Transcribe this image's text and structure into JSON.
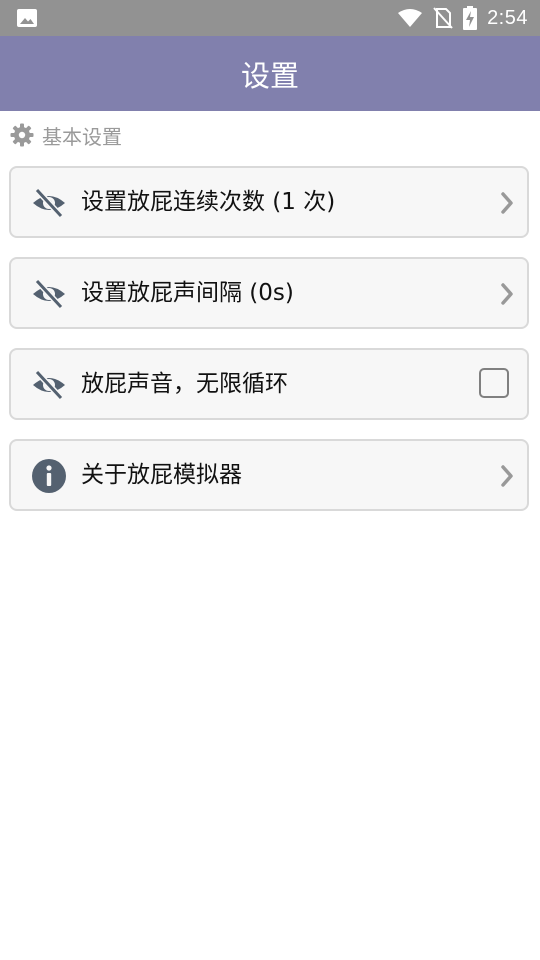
{
  "status_bar": {
    "time": "2:54",
    "left_icon": "image-icon",
    "icons": [
      "wifi-icon",
      "no-sim-icon",
      "battery-charging-icon"
    ]
  },
  "app_bar": {
    "title": "设置"
  },
  "section": {
    "icon": "gear-icon",
    "title": "基本设置"
  },
  "settings": [
    {
      "icon": "eye-off-icon",
      "label": "设置放屁连续次数 (1 次)",
      "control": "chevron"
    },
    {
      "icon": "eye-off-icon",
      "label": "设置放屁声间隔 (0s)",
      "control": "chevron"
    },
    {
      "icon": "eye-off-icon",
      "label": "放屁声音，无限循环",
      "control": "checkbox",
      "checked": false
    },
    {
      "icon": "info-icon",
      "label": "关于放屁模拟器",
      "control": "chevron"
    }
  ],
  "colors": {
    "app_bar": "#8180ad",
    "status_bar": "#929292",
    "icon": "#546170",
    "card_bg": "#f7f7f7",
    "card_border": "#d9d9d9"
  }
}
